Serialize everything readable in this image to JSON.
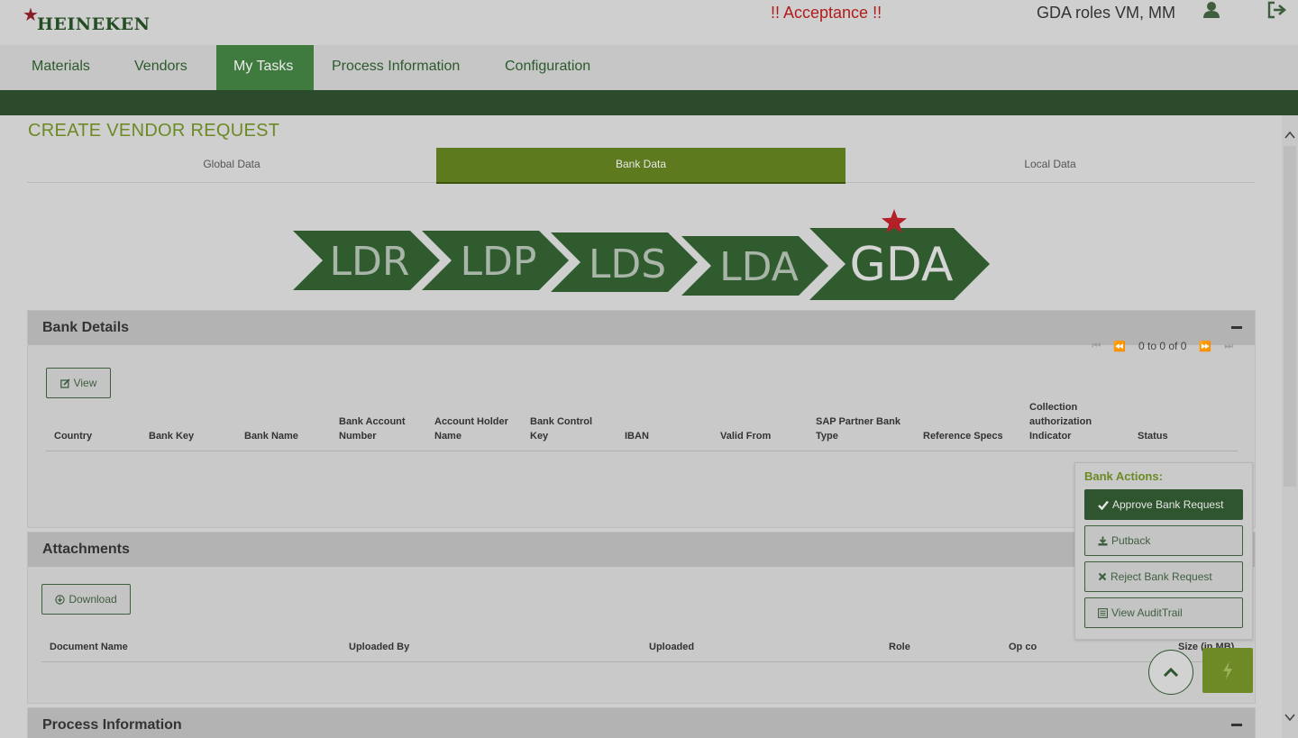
{
  "header": {
    "logo_text": "HEINEKEN",
    "environment": "!! Acceptance !!",
    "user_roles": "GDA roles VM, MM"
  },
  "nav": {
    "items": [
      {
        "label": "Materials",
        "active": false
      },
      {
        "label": "Vendors",
        "active": false
      },
      {
        "label": "My Tasks",
        "active": true
      },
      {
        "label": "Process Information",
        "active": false
      },
      {
        "label": "Configuration",
        "active": false
      }
    ]
  },
  "page": {
    "title": "CREATE VENDOR REQUEST",
    "tabs": [
      {
        "label": "Global Data",
        "active": false
      },
      {
        "label": "Bank Data",
        "active": true
      },
      {
        "label": "Local Data",
        "active": false
      }
    ],
    "stages": [
      "LDR",
      "LDP",
      "LDS",
      "LDA",
      "GDA"
    ],
    "current_stage": "GDA"
  },
  "bank_details": {
    "title": "Bank Details",
    "view_button": "View",
    "pager_text": "0 to 0 of 0",
    "columns": [
      "Country",
      "Bank Key",
      "Bank Name",
      "Bank Account Number",
      "Account Holder Name",
      "Bank Control Key",
      "IBAN",
      "Valid From",
      "SAP Partner Bank Type",
      "Reference Specs",
      "Collection authorization Indicator",
      "Status"
    ]
  },
  "attachments": {
    "title": "Attachments",
    "download_button": "Download",
    "columns": [
      "Document Name",
      "Uploaded By",
      "Uploaded",
      "Role",
      "Op co",
      "Size (in MB)"
    ]
  },
  "process_information": {
    "title": "Process Information"
  },
  "bank_actions": {
    "title": "Bank Actions:",
    "buttons": [
      {
        "label": "Approve Bank Request",
        "icon": "check-icon"
      },
      {
        "label": "Putback",
        "icon": "download-icon"
      },
      {
        "label": "Reject Bank Request",
        "icon": "close-icon"
      },
      {
        "label": "View AuditTrail",
        "icon": "list-icon"
      }
    ]
  },
  "colors": {
    "brand_green": "#2e552e",
    "accent_olive": "#6b8a24",
    "env_red": "#b21b1b",
    "star_red": "#b3202a"
  }
}
